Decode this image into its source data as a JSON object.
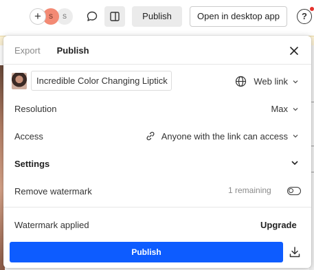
{
  "toolbar": {
    "add_collaborator_glyph": "+",
    "avatars": [
      "S",
      "S"
    ],
    "publish_label": "Publish",
    "open_desktop_label": "Open in desktop app",
    "help_glyph": "?",
    "icons": [
      "plus-icon",
      "comment-icon",
      "panel-icon",
      "help-icon"
    ],
    "notification_color": "#e5322d"
  },
  "modal": {
    "tabs": [
      {
        "label": "Export",
        "active": false
      },
      {
        "label": "Publish",
        "active": true
      }
    ],
    "design_name": "Incredible Color Changing Liptick",
    "link_type": "Web link",
    "resolution": {
      "label": "Resolution",
      "value": "Max"
    },
    "access": {
      "label": "Access",
      "value": "Anyone with the link can access"
    },
    "settings": {
      "label": "Settings"
    },
    "watermark": {
      "label": "Remove watermark",
      "remaining": "1 remaining",
      "enabled": false
    },
    "watermark_applied": {
      "label": "Watermark applied",
      "action": "Upgrade"
    },
    "publish_button": "Publish",
    "accent_color": "#0d5cff"
  }
}
